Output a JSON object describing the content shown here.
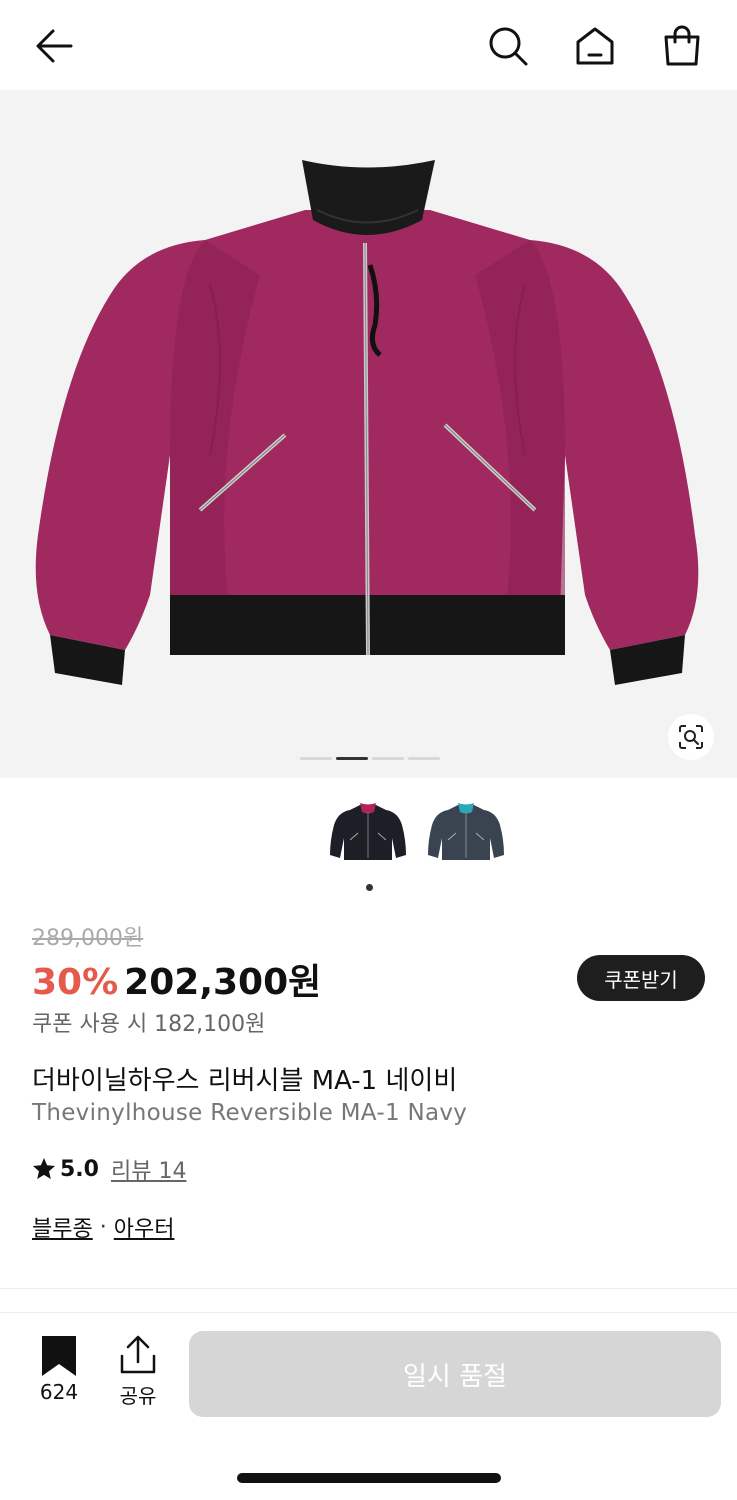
{
  "header": {
    "back_icon": "arrow-left-icon",
    "search_icon": "search-icon",
    "home_icon": "home-icon",
    "cart_icon": "shopping-bag-icon"
  },
  "gallery": {
    "image": "pink reversible MA-1 bomber jacket",
    "slide_count": 4,
    "active_slide": 2,
    "lens_icon": "image-search-icon"
  },
  "color_options": [
    {
      "name": "black variant",
      "active": true
    },
    {
      "name": "navy variant",
      "active": false
    }
  ],
  "price": {
    "original": "289,000원",
    "discount": "30%",
    "sale": "202,300원",
    "coupon_price": "쿠폰 사용 시 182,100원",
    "coupon_button": "쿠폰받기"
  },
  "product": {
    "name_ko": "더바이닐하우스 리버시블 MA-1 네이비",
    "name_en": "Thevinylhouse Reversible MA-1 Navy"
  },
  "rating": {
    "score": "5.0",
    "review_label": "리뷰 14"
  },
  "categories": [
    "블루종",
    "아우터"
  ],
  "bottom_bar": {
    "bookmark_count": "624",
    "share_label": "공유",
    "soldout_label": "일시 품절"
  },
  "colors": {
    "discount": "#e65a4b",
    "disabled_button": "#d6d6d6",
    "jacket_pink": "#a02a5f"
  }
}
